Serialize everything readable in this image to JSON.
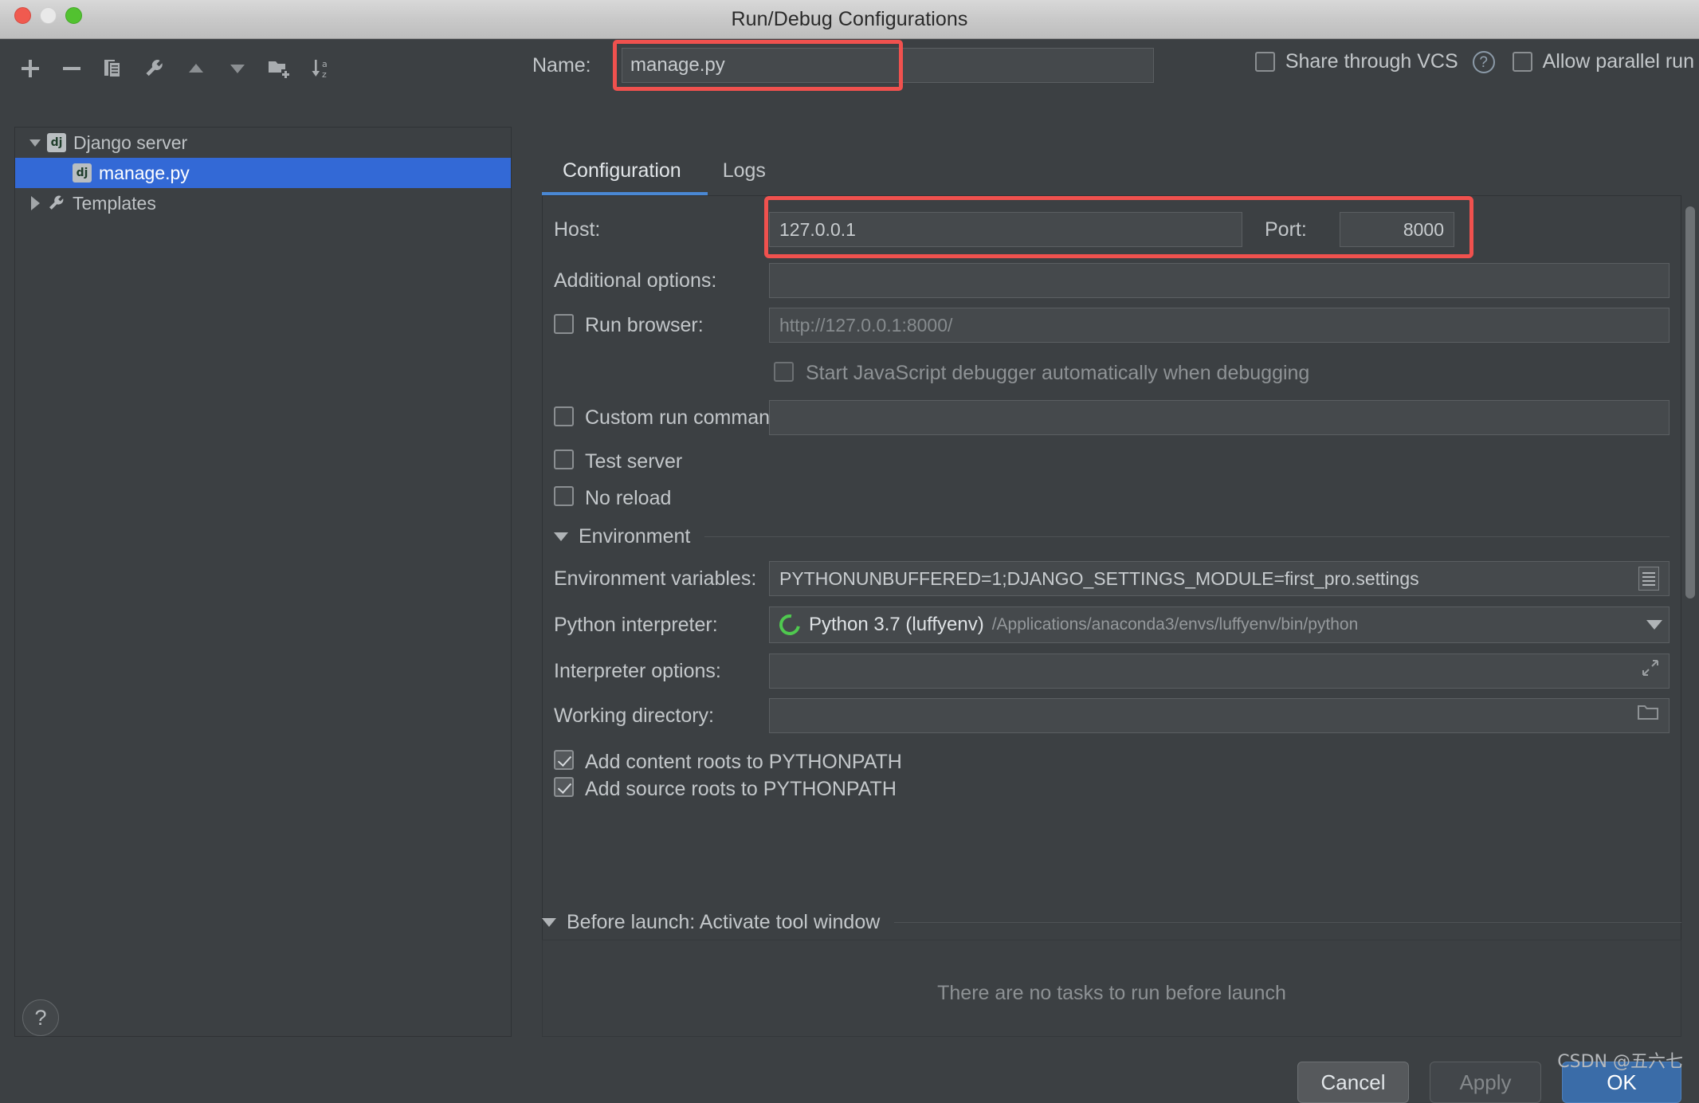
{
  "window": {
    "title": "Run/Debug Configurations",
    "traffic_lights": [
      "close",
      "minimize",
      "zoom"
    ]
  },
  "toolbar": {
    "buttons": [
      {
        "name": "add",
        "icon": "plus-icon"
      },
      {
        "name": "remove",
        "icon": "minus-icon"
      },
      {
        "name": "copy",
        "icon": "copy-icon"
      },
      {
        "name": "edit-templates",
        "icon": "wrench-icon"
      },
      {
        "name": "move-up",
        "icon": "triangle-up-icon"
      },
      {
        "name": "move-down",
        "icon": "triangle-down-icon"
      },
      {
        "name": "new-folder",
        "icon": "folder-add-icon"
      },
      {
        "name": "sort-alphabetically",
        "icon": "sort-az-icon"
      }
    ]
  },
  "tree": {
    "items": [
      {
        "label": "Django server",
        "icon": "dj-icon",
        "twisty": "down",
        "level": 0,
        "selected": false
      },
      {
        "label": "manage.py",
        "icon": "dj-icon",
        "twisty": "none",
        "level": 1,
        "selected": true
      },
      {
        "label": "Templates",
        "icon": "wrench-icon",
        "twisty": "right",
        "level": 0,
        "selected": false
      }
    ]
  },
  "name_row": {
    "label": "Name:",
    "value": "manage.py"
  },
  "top_options": {
    "share_through_vcs": {
      "label": "Share through VCS",
      "checked": false
    },
    "help_icon": "question-mark-icon",
    "allow_parallel_run": {
      "label": "Allow parallel run",
      "checked": false
    }
  },
  "tabs": [
    {
      "label": "Configuration",
      "active": true
    },
    {
      "label": "Logs",
      "active": false
    }
  ],
  "config": {
    "host": {
      "label": "Host:",
      "value": "127.0.0.1"
    },
    "port": {
      "label": "Port:",
      "value": "8000"
    },
    "additional_options": {
      "label": "Additional options:",
      "value": ""
    },
    "run_browser": {
      "label": "Run browser:",
      "checked": false,
      "placeholder": "http://127.0.0.1:8000/"
    },
    "start_js_debugger": {
      "label": "Start JavaScript debugger automatically when debugging",
      "checked": false
    },
    "custom_run_command": {
      "label": "Custom run command:",
      "checked": false,
      "value": ""
    },
    "test_server": {
      "label": "Test server",
      "checked": false
    },
    "no_reload": {
      "label": "No reload",
      "checked": false
    },
    "environment_section": {
      "label": "Environment"
    },
    "environment_variables": {
      "label": "Environment variables:",
      "value": "PYTHONUNBUFFERED=1;DJANGO_SETTINGS_MODULE=first_pro.settings",
      "browse_icon": "list-edit-icon"
    },
    "python_interpreter": {
      "label": "Python interpreter:",
      "icon": "python-env-icon",
      "value": "Python 3.7 (luffyenv)",
      "path": "/Applications/anaconda3/envs/luffyenv/bin/python",
      "dropdown_icon": "chevron-down-icon"
    },
    "interpreter_options": {
      "label": "Interpreter options:",
      "value": "",
      "expand_icon": "expand-icon"
    },
    "working_directory": {
      "label": "Working directory:",
      "value": "",
      "folder_icon": "folder-icon"
    },
    "add_content_roots": {
      "label": "Add content roots to PYTHONPATH",
      "checked": true
    },
    "add_source_roots": {
      "label": "Add source roots to PYTHONPATH",
      "checked": true
    }
  },
  "before_launch": {
    "title": "Before launch: Activate tool window",
    "empty_text": "There are no tasks to run before launch"
  },
  "footer": {
    "help_label": "?",
    "cancel_label": "Cancel",
    "apply_label": "Apply",
    "ok_label": "OK"
  },
  "watermark": "CSDN @五六七",
  "colors": {
    "accent_blue": "#3369d6",
    "tab_underline": "#4a88d4",
    "highlight_red": "#f0514e",
    "ok_button": "#3a6ca8",
    "panel_bg": "#3c4043",
    "field_bg": "#45494c"
  }
}
